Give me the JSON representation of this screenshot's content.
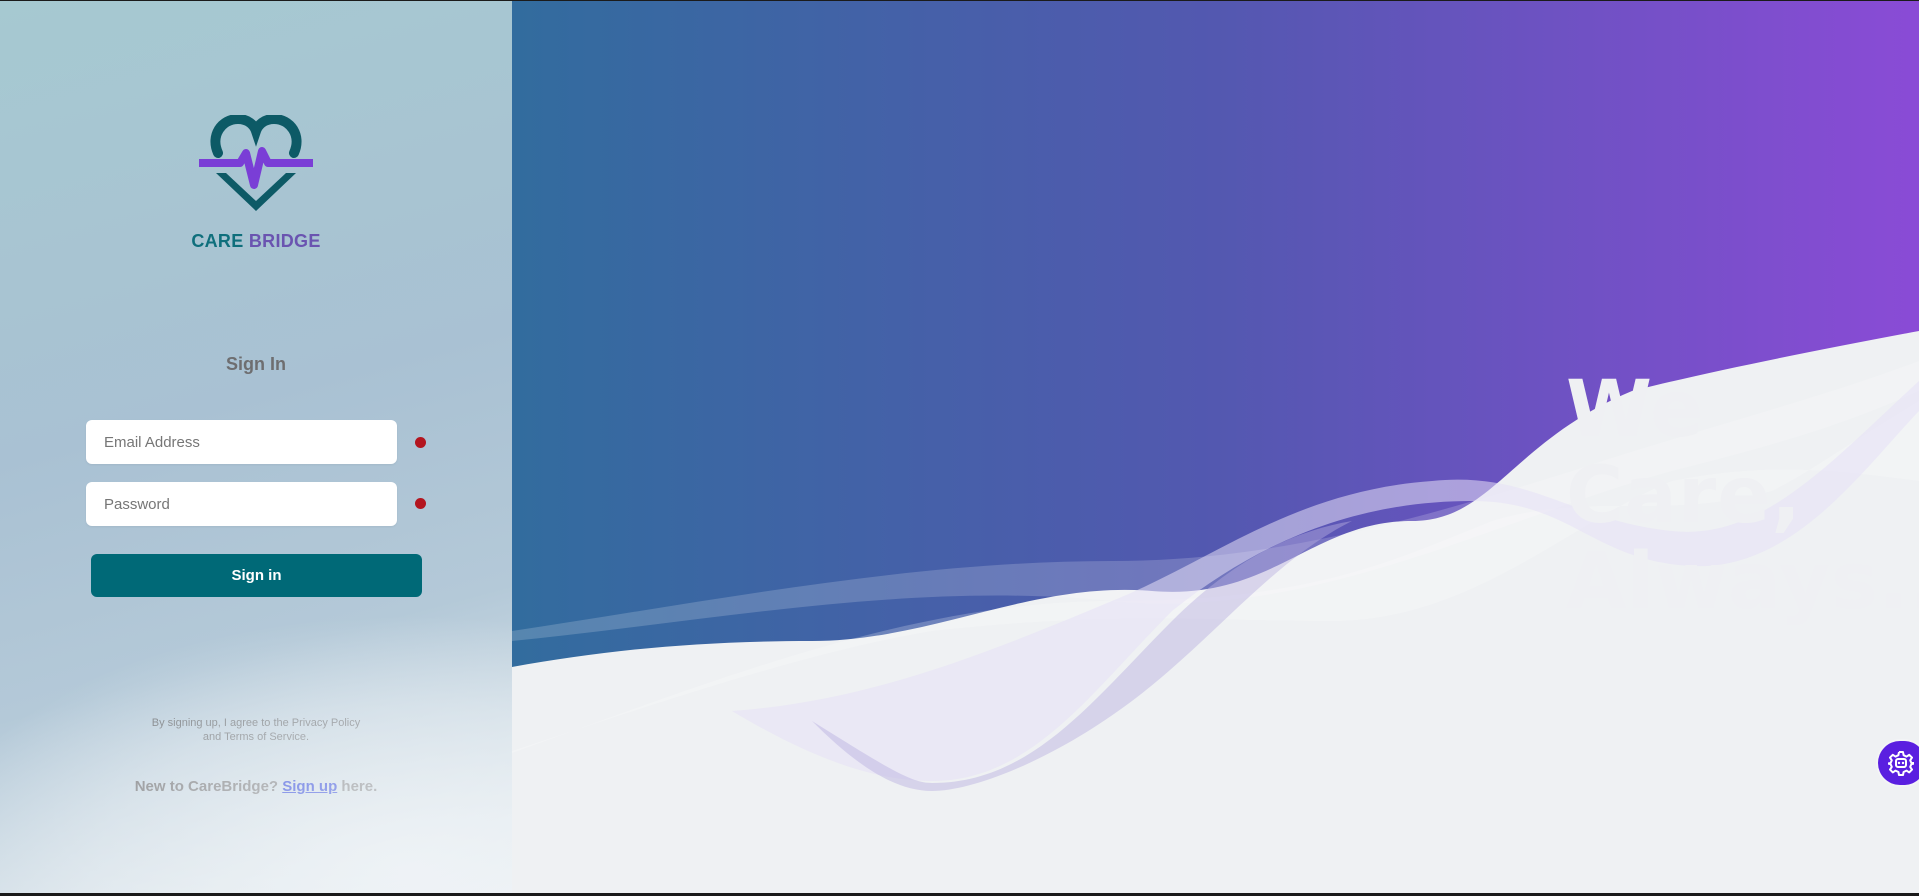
{
  "brand": {
    "name_part1": "CARE",
    "name_part2": "BRIDGE"
  },
  "signin": {
    "title": "Sign In",
    "email_placeholder": "Email Address",
    "password_placeholder": "Password",
    "submit_label": "Sign in"
  },
  "terms": {
    "line1": "By signing up, I agree to the Privacy Policy",
    "line2": "and Terms of Service."
  },
  "signup": {
    "prefix": "New to CareBridge?",
    "link": "Sign up",
    "suffix": "here."
  },
  "hero": {
    "line1": "We Care,",
    "line2": "Always.."
  },
  "icons": {
    "logo": "heart-pulse-icon",
    "required": "required-dot-icon",
    "fab": "gear-icon"
  },
  "colors": {
    "primary": "#006977",
    "brand_teal": "#0f6f7c",
    "brand_purple": "#6a54b0",
    "required": "#b3151f",
    "accent": "#5a1fe0"
  }
}
